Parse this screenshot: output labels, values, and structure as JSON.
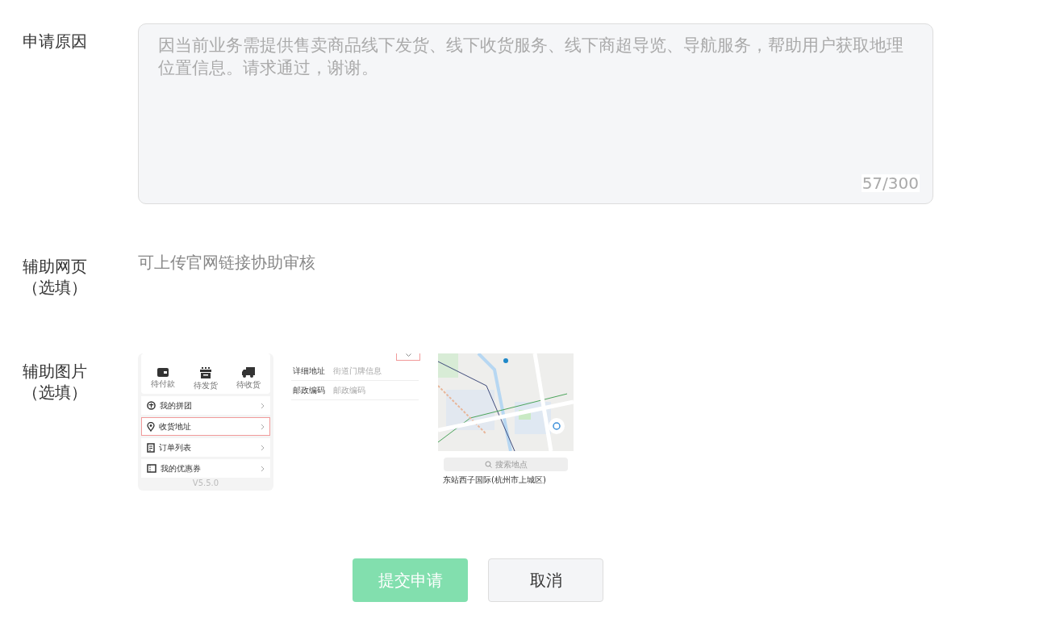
{
  "fields": [
    {
      "kind": "textarea",
      "label": "申请原因",
      "value": "因当前业务需提供售卖商品线下发货、线下收货服务、线下商超导览、导航服务，帮助用户获取地理位置信息。请求通过，谢谢。",
      "counter": "57/300"
    },
    {
      "kind": "hint",
      "label": "辅助网页",
      "note": "（选填）",
      "hint": "可上传官网链接协助审核"
    },
    {
      "kind": "images",
      "label": "辅助图片",
      "note": "（选填）",
      "images": [
        {
          "kind": "menu_screen",
          "orders": [
            "待付款",
            "待发货",
            "待收货"
          ],
          "menu": [
            {
              "label": "我的拼团",
              "selected": false
            },
            {
              "label": "收货地址",
              "selected": true
            },
            {
              "label": "订单列表",
              "selected": false
            },
            {
              "label": "我的优惠券",
              "selected": false
            }
          ],
          "version": "V5.5.0"
        },
        {
          "kind": "address_form",
          "rows": [
            {
              "label": "详细地址",
              "placeholder": "街道门牌信息"
            },
            {
              "label": "邮政编码",
              "placeholder": "邮政编码"
            }
          ]
        },
        {
          "kind": "map_screen",
          "search": {
            "placeholder": "搜索地点"
          },
          "result": "东站西子国际(杭州市上城区)"
        }
      ]
    }
  ],
  "buttons": [
    {
      "label": "提交申请",
      "kind": "primary",
      "disabled": true
    },
    {
      "label": "取消",
      "kind": "secondary",
      "disabled": false
    }
  ]
}
